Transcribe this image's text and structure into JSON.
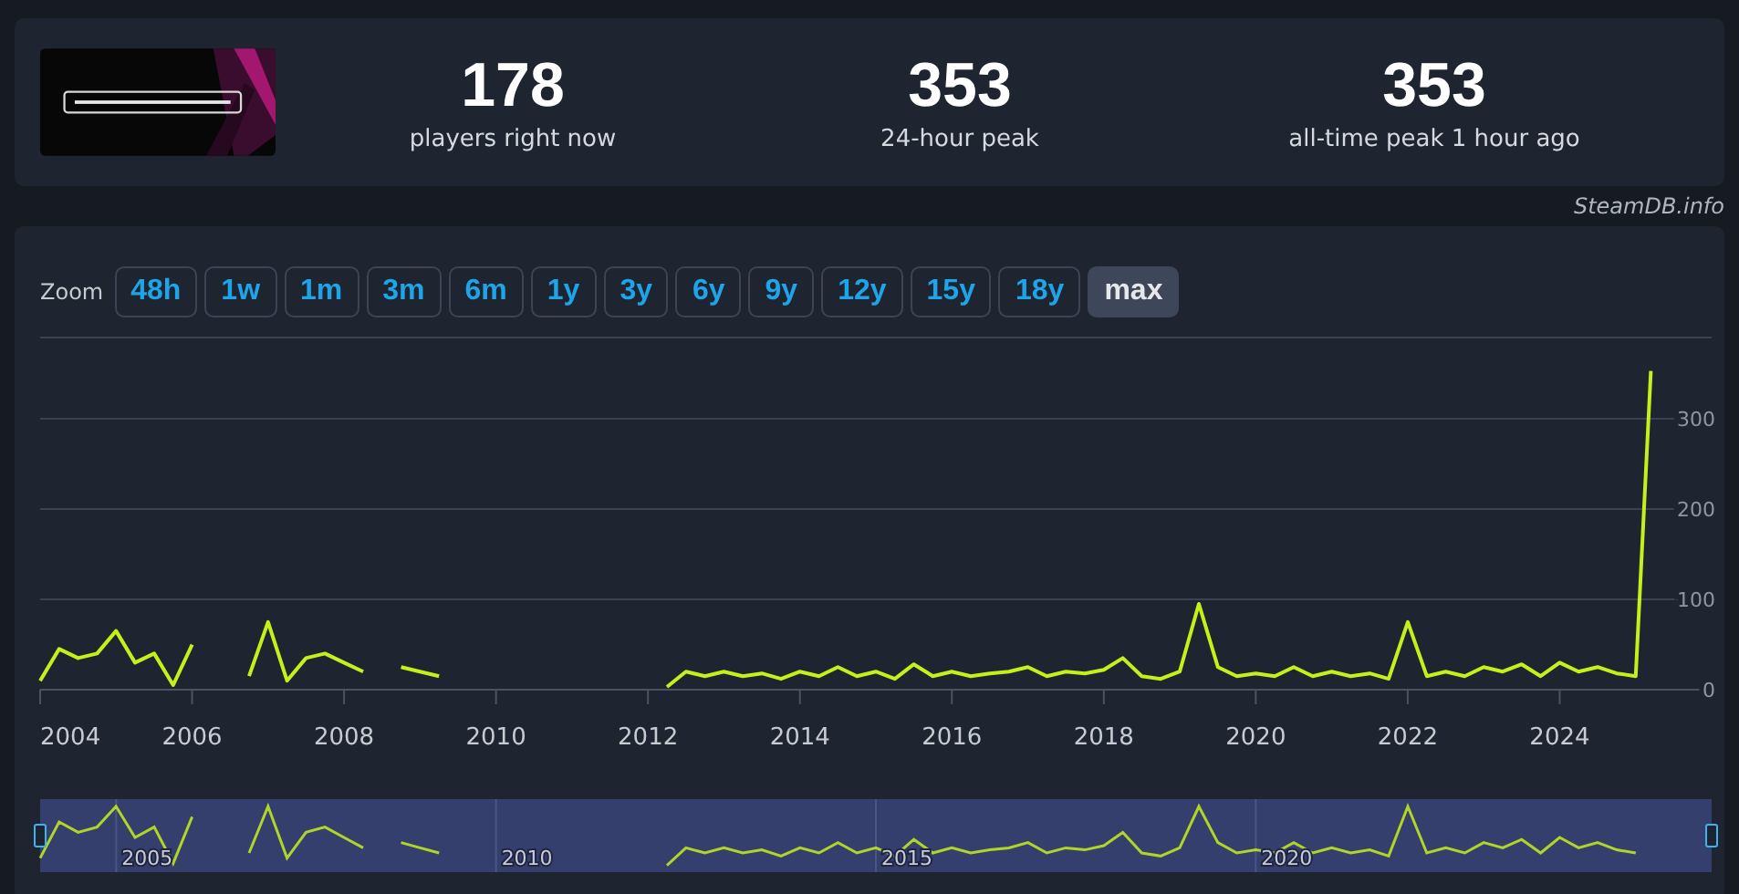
{
  "header": {
    "stats": [
      {
        "value": "178",
        "label": "players right now"
      },
      {
        "value": "353",
        "label": "24-hour peak"
      },
      {
        "value": "353",
        "label": "all-time peak 1 hour ago"
      }
    ]
  },
  "credit": "SteamDB.info",
  "zoom": {
    "label": "Zoom",
    "buttons": [
      {
        "label": "48h",
        "selected": false
      },
      {
        "label": "1w",
        "selected": false
      },
      {
        "label": "1m",
        "selected": false
      },
      {
        "label": "3m",
        "selected": false
      },
      {
        "label": "6m",
        "selected": false
      },
      {
        "label": "1y",
        "selected": false
      },
      {
        "label": "3y",
        "selected": false
      },
      {
        "label": "6y",
        "selected": false
      },
      {
        "label": "9y",
        "selected": false
      },
      {
        "label": "12y",
        "selected": false
      },
      {
        "label": "15y",
        "selected": false
      },
      {
        "label": "18y",
        "selected": false
      },
      {
        "label": "max",
        "selected": true
      }
    ]
  },
  "chart_data": {
    "type": "line",
    "xlim": [
      2004,
      2026
    ],
    "ylim": [
      0,
      390
    ],
    "grid": true,
    "xticks": [
      2004,
      2006,
      2008,
      2010,
      2012,
      2014,
      2016,
      2018,
      2020,
      2022,
      2024
    ],
    "yticks": [
      0,
      100,
      200,
      300
    ],
    "x": [
      2004,
      2004.25,
      2004.5,
      2004.75,
      2005,
      2005.25,
      2005.5,
      2005.75,
      2006,
      2006.25,
      2006.5,
      2006.75,
      2007,
      2007.25,
      2007.5,
      2007.75,
      2008,
      2008.25,
      2008.5,
      2008.75,
      2009,
      2009.25,
      2009.5,
      2009.75,
      2010,
      2010.25,
      2010.5,
      2010.75,
      2011,
      2011.25,
      2011.5,
      2011.75,
      2012,
      2012.25,
      2012.5,
      2012.75,
      2013,
      2013.25,
      2013.5,
      2013.75,
      2014,
      2014.25,
      2014.5,
      2014.75,
      2015,
      2015.25,
      2015.5,
      2015.75,
      2016,
      2016.25,
      2016.5,
      2016.75,
      2017,
      2017.25,
      2017.5,
      2017.75,
      2018,
      2018.25,
      2018.5,
      2018.75,
      2019,
      2019.25,
      2019.5,
      2019.75,
      2020,
      2020.25,
      2020.5,
      2020.75,
      2021,
      2021.25,
      2021.5,
      2021.75,
      2022,
      2022.25,
      2022.5,
      2022.75,
      2023,
      2023.25,
      2023.5,
      2023.75,
      2024,
      2024.25,
      2024.5,
      2024.75,
      2025,
      2025.2
    ],
    "series": [
      {
        "color": "#c6f01a",
        "values": [
          10,
          45,
          35,
          40,
          65,
          30,
          40,
          5,
          50,
          null,
          null,
          15,
          75,
          10,
          35,
          40,
          30,
          20,
          null,
          25,
          20,
          15,
          null,
          null,
          null,
          null,
          null,
          null,
          null,
          null,
          null,
          null,
          null,
          3,
          20,
          15,
          20,
          15,
          18,
          12,
          20,
          15,
          25,
          15,
          20,
          12,
          28,
          15,
          20,
          15,
          18,
          20,
          25,
          15,
          20,
          18,
          22,
          35,
          15,
          12,
          20,
          95,
          25,
          15,
          18,
          15,
          25,
          15,
          20,
          15,
          18,
          12,
          75,
          15,
          20,
          15,
          25,
          20,
          28,
          15,
          30,
          20,
          25,
          18,
          15,
          353
        ]
      }
    ]
  },
  "navigator": {
    "labels": [
      "2005",
      "2010",
      "2015",
      "2020"
    ]
  }
}
